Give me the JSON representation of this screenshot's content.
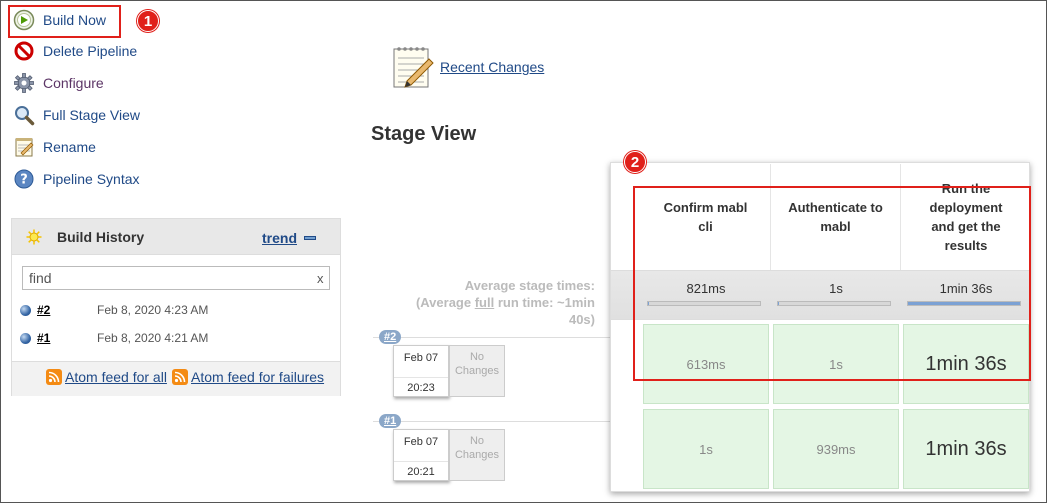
{
  "sidebar": {
    "tasks": [
      {
        "label": "Build Now",
        "icon": "build-now-icon"
      },
      {
        "label": "Delete Pipeline",
        "icon": "delete-icon"
      },
      {
        "label": "Configure",
        "icon": "gear-icon"
      },
      {
        "label": "Full Stage View",
        "icon": "magnifier-icon"
      },
      {
        "label": "Rename",
        "icon": "notepad-icon"
      },
      {
        "label": "Pipeline Syntax",
        "icon": "help-icon"
      }
    ]
  },
  "callouts": {
    "one": "1",
    "two": "2"
  },
  "build_history": {
    "title": "Build History",
    "trend_label": "trend",
    "search_placeholder": "find",
    "clear_label": "x",
    "builds": [
      {
        "number": "#2",
        "date": "Feb 8, 2020 4:23 AM"
      },
      {
        "number": "#1",
        "date": "Feb 8, 2020 4:21 AM"
      }
    ],
    "feed_all": "Atom feed for all",
    "feed_failures": "Atom feed for failures"
  },
  "main": {
    "recent_changes": "Recent Changes",
    "stage_view_title": "Stage View",
    "avg_line1": "Average stage times:",
    "avg_line2_prefix": "(Average ",
    "avg_line2_full": "full",
    "avg_line2_suffix": " run time: ~1min",
    "avg_line3": "40s)"
  },
  "runs": [
    {
      "number": "#2",
      "date": "Feb 07",
      "time": "20:23",
      "changes_line1": "No",
      "changes_line2": "Changes"
    },
    {
      "number": "#1",
      "date": "Feb 07",
      "time": "20:21",
      "changes_line1": "No",
      "changes_line2": "Changes"
    }
  ],
  "stages": {
    "headers": [
      "Confirm mabl cli",
      "Authenticate to mabl",
      "Run the deployment and get the results"
    ],
    "averages": [
      "821ms",
      "1s",
      "1min 36s"
    ],
    "average_fraction": [
      0.01,
      0.01,
      1.0
    ],
    "rows": [
      [
        "613ms",
        "1s",
        "1min 36s"
      ],
      [
        "1s",
        "939ms",
        "1min 36s"
      ]
    ]
  },
  "colors": {
    "callout_red": "#e0201a",
    "link_blue": "#204a87",
    "stage_success_green": "#e4f6e4"
  }
}
